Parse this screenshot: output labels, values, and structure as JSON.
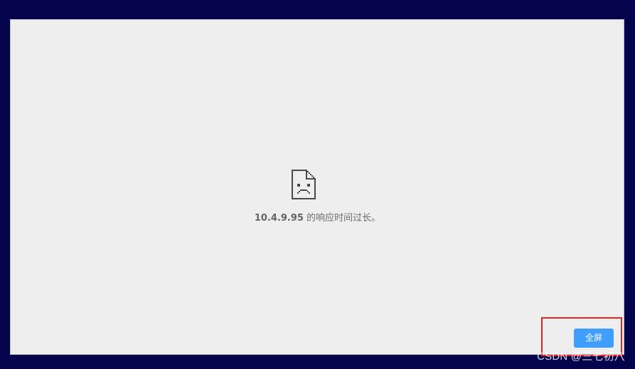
{
  "error": {
    "icon": "sad-page-icon",
    "host": "10.4.9.95",
    "message_suffix": " 的响应时间过长。"
  },
  "controls": {
    "fullscreen_label": "全屏"
  },
  "watermark": {
    "text": "CSDN @三七初八"
  },
  "colors": {
    "background": "#06034d",
    "page": "#eeeeee",
    "button": "#409eff",
    "highlight": "#e8241f"
  }
}
